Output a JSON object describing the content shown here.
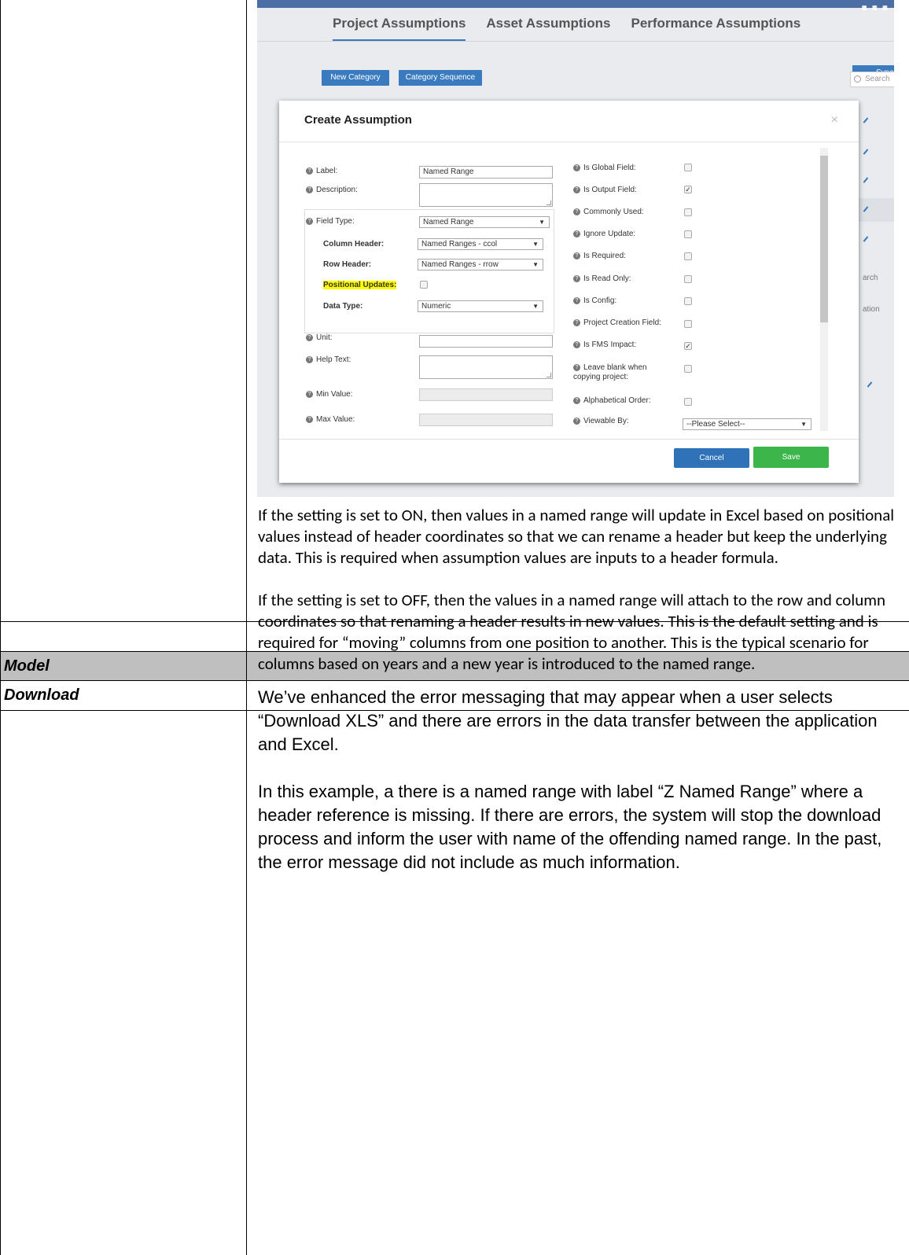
{
  "screenshot": {
    "brand_partial": "...",
    "tabs": [
      "Project Assumptions",
      "Asset Assumptions",
      "Performance Assumptions"
    ],
    "sync_label": "Sync",
    "toolbar": {
      "new_category": "New Category",
      "category_sequence": "Category Sequence"
    },
    "search_placeholder": "Search",
    "background_fragments": {
      "search2": "arch",
      "action": "ation"
    },
    "modal": {
      "title": "Create Assumption",
      "close": "×",
      "left_fields": {
        "label": {
          "label": "Label:",
          "value": "Named Range"
        },
        "description": {
          "label": "Description:"
        },
        "field_type": {
          "label": "Field Type:",
          "value": "Named Range"
        },
        "column_header": {
          "label": "Column Header:",
          "value": "Named Ranges - ccol"
        },
        "row_header": {
          "label": "Row Header:",
          "value": "Named Ranges - rrow"
        },
        "positional_updates": {
          "label": "Positional Updates:",
          "checked": false
        },
        "data_type": {
          "label": "Data Type:",
          "value": "Numeric"
        },
        "unit": {
          "label": "Unit:"
        },
        "help_text": {
          "label": "Help Text:"
        },
        "min_value": {
          "label": "Min Value:"
        },
        "max_value": {
          "label": "Max Value:"
        }
      },
      "right_fields": [
        {
          "label": "Is Global Field:",
          "checked": false
        },
        {
          "label": "Is Output Field:",
          "checked": true
        },
        {
          "label": "Commonly Used:",
          "checked": false
        },
        {
          "label": "Ignore Update:",
          "checked": false
        },
        {
          "label": "Is Required:",
          "checked": false
        },
        {
          "label": "Is Read Only:",
          "checked": false
        },
        {
          "label": "Is Config:",
          "checked": false
        },
        {
          "label": "Project Creation Field:",
          "checked": false
        },
        {
          "label": "Is FMS Impact:",
          "checked": true
        },
        {
          "label": "Leave blank when copying project:",
          "checked": false
        },
        {
          "label": "Alphabetical Order:",
          "checked": false
        }
      ],
      "viewable_by": {
        "label": "Viewable By:",
        "value": "--Please Select--"
      },
      "cancel": "Cancel",
      "save": "Save"
    }
  },
  "doc": {
    "para1": "If the setting is set to ON, then values in a named range will update in Excel based on positional values instead of header coordinates so that we can rename a header but keep the underlying data.  This is required when assumption values are inputs to a header formula.",
    "para2": "If the setting is set to OFF, then the values in a named range will attach to the row and column coordinates so that renaming a header results in new values.  This is the default setting and is required for “moving” columns from one position to another.  This is the typical scenario for columns based on years and a new year is introduced to the named range.",
    "row_model": "Model",
    "row_download": "Download",
    "download_para1": "We’ve enhanced the error messaging that may appear when a user selects “Download XLS” and there are errors in the data transfer between the application and Excel.",
    "download_para2": "In this example, a there is a named range with label  “Z Named Range” where a header reference is missing.  If there are errors, the system will stop the download process and inform the user with name of the offending named range.  In the past, the error message did not include as much information."
  }
}
